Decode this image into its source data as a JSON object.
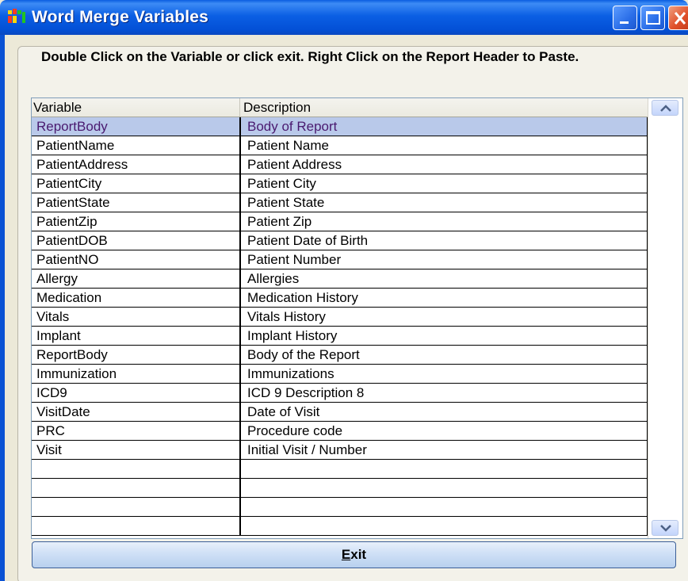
{
  "window": {
    "title": "Word Merge Variables",
    "accent": "#0a5ee0",
    "close_color": "#e0502a"
  },
  "instructions": "Double Click on the Variable or click exit.  Right Click on the Report Header to Paste.",
  "grid": {
    "columns": [
      "Variable",
      "Description"
    ],
    "selected_row": 0,
    "rows": [
      {
        "variable": "ReportBody",
        "description": "Body of Report"
      },
      {
        "variable": "PatientName",
        "description": "Patient Name"
      },
      {
        "variable": "PatientAddress",
        "description": "Patient Address"
      },
      {
        "variable": "PatientCity",
        "description": "Patient City"
      },
      {
        "variable": "PatientState",
        "description": "Patient State"
      },
      {
        "variable": "PatientZip",
        "description": "Patient Zip"
      },
      {
        "variable": "PatientDOB",
        "description": "Patient Date of Birth"
      },
      {
        "variable": "PatientNO",
        "description": "Patient Number"
      },
      {
        "variable": "Allergy",
        "description": "Allergies"
      },
      {
        "variable": "Medication",
        "description": "Medication History"
      },
      {
        "variable": "Vitals",
        "description": "Vitals History"
      },
      {
        "variable": "Implant",
        "description": "Implant History"
      },
      {
        "variable": "ReportBody",
        "description": "Body of the Report"
      },
      {
        "variable": "Immunization",
        "description": "Immunizations"
      },
      {
        "variable": "ICD9",
        "description": "ICD 9 Description 8"
      },
      {
        "variable": "VisitDate",
        "description": "Date of Visit"
      },
      {
        "variable": "PRC",
        "description": "Procedure code"
      },
      {
        "variable": "Visit",
        "description": "Initial Visit / Number"
      },
      {
        "variable": "",
        "description": ""
      },
      {
        "variable": "",
        "description": ""
      },
      {
        "variable": "",
        "description": ""
      },
      {
        "variable": "",
        "description": ""
      }
    ],
    "selected_color": "#b9c9ea"
  },
  "exit_button": {
    "label_mnemonic": "E",
    "label_rest": "xit"
  },
  "icons": {
    "app": "app-icon",
    "minimize": "minimize-icon",
    "maximize": "maximize-icon",
    "close": "close-icon",
    "scroll_up": "scroll-up-icon",
    "scroll_down": "scroll-down-icon"
  }
}
